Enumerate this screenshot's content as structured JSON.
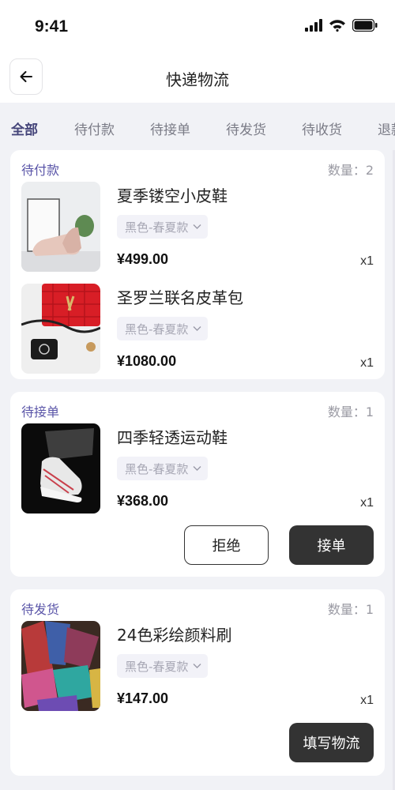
{
  "status_bar": {
    "time": "9:41"
  },
  "header": {
    "title": "快递物流"
  },
  "tabs": [
    {
      "label": "全部",
      "active": true
    },
    {
      "label": "待付款",
      "active": false
    },
    {
      "label": "待接单",
      "active": false
    },
    {
      "label": "待发货",
      "active": false
    },
    {
      "label": "待收货",
      "active": false
    },
    {
      "label": "退款",
      "active": false
    }
  ],
  "orders": [
    {
      "status": "待付款",
      "count": "数量：2",
      "items": [
        {
          "name": "夏季镂空小皮鞋",
          "spec": "黑色-春夏款",
          "price": "¥499.00",
          "qty": "x1"
        },
        {
          "name": "圣罗兰联名皮革包",
          "spec": "黑色-春夏款",
          "price": "¥1080.00",
          "qty": "x1"
        }
      ]
    },
    {
      "status": "待接单",
      "count": "数量：1",
      "items": [
        {
          "name": "四季轻透运动鞋",
          "spec": "黑色-春夏款",
          "price": "¥368.00",
          "qty": "x1"
        }
      ],
      "actions": [
        "拒绝",
        "接单"
      ]
    },
    {
      "status": "待发货",
      "count": "数量：1",
      "items": [
        {
          "name": "24色彩绘颜料刷",
          "spec": "黑色-春夏款",
          "price": "¥147.00",
          "qty": "x1"
        }
      ],
      "actions": [
        "填写物流"
      ]
    }
  ],
  "colors": {
    "accent": "#5a55a8",
    "dark_button": "#333333",
    "background": "#f1f2f6"
  }
}
